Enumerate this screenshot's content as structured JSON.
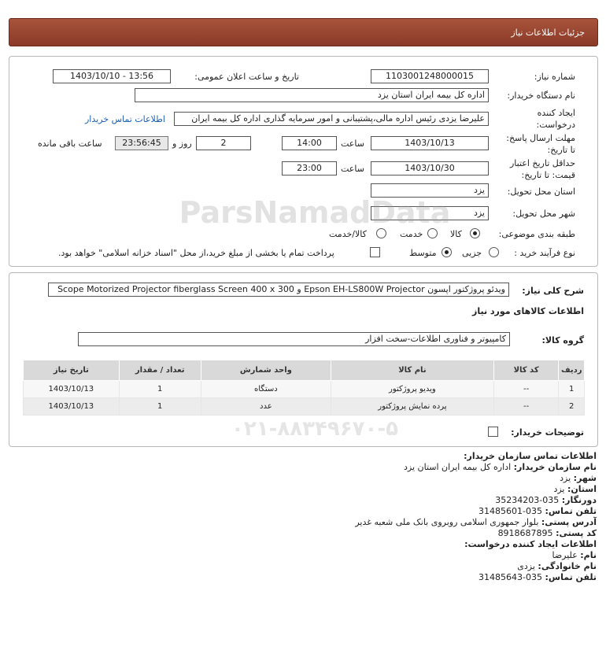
{
  "header": {
    "title": "جزئیات اطلاعات نیاز"
  },
  "form": {
    "need_number_label": "شماره نیاز:",
    "need_number": "1103001248000015",
    "announce_label": "تاریخ و ساعت اعلان عمومی:",
    "announce_value": "1403/10/10 - 13:56",
    "buyer_org_label": "نام دستگاه خریدار:",
    "buyer_org": "اداره کل بیمه ایران استان یزد",
    "creator_label_1": "ایجاد کننده",
    "creator_label_2": "درخواست:",
    "creator": "علیرضا یزدی رئیس اداره مالی،پشتیبانی و امور سرمایه گذاری اداره کل بیمه ایران",
    "buyer_contact_link": "اطلاعات تماس خریدار",
    "reply_deadline_label_1": "مهلت ارسال پاسخ:",
    "reply_deadline_label_2": "تا تاریخ:",
    "reply_date": "1403/10/13",
    "time_label": "ساعت",
    "reply_time": "14:00",
    "days_value": "2",
    "days_label": "روز و",
    "remaining_time": "23:56:45",
    "remaining_label": "ساعت باقی مانده",
    "validity_label_1": "حداقل تاریخ اعتبار",
    "validity_label_2": "قیمت: تا تاریخ:",
    "validity_date": "1403/10/30",
    "validity_time": "23:00",
    "province_label": "استان محل تحویل:",
    "province": "یزد",
    "city_label": "شهر محل تحویل:",
    "city": "یزد",
    "category_label": "طبقه بندی موضوعی:",
    "cat_goods": "کالا",
    "cat_service": "خدمت",
    "cat_goods_service": "کالا/خدمت",
    "process_label": "نوع فرآیند خرید :",
    "proc_partial": "جزیی",
    "proc_medium": "متوسط",
    "payment_note": "پرداخت تمام یا بخشی از مبلغ خرید،از محل \"اسناد خزانه اسلامی\" خواهد بود."
  },
  "need": {
    "desc_label": "شرح کلی نیاز:",
    "desc": "ویدئو پروژکتور اپسون Epson EH-LS800W Projector و Scope Motorized Projector fiberglass Screen 400 x 300",
    "goods_info_title": "اطلاعات کالاهای مورد نیاز",
    "group_label": "گروه کالا:",
    "group_value": "کامپیوتر و فناوری اطلاعات-سخت افزار",
    "table": {
      "headers": [
        "ردیف",
        "کد کالا",
        "نام کالا",
        "واحد شمارش",
        "تعداد / مقدار",
        "تاریخ نیاز"
      ],
      "rows": [
        [
          "1",
          "--",
          "ویدیو پروژکتور",
          "دستگاه",
          "1",
          "1403/10/13"
        ],
        [
          "2",
          "--",
          "پرده نمایش پروژکتور",
          "عدد",
          "1",
          "1403/10/13"
        ]
      ]
    },
    "buyer_notes_label": "توضیحات خریدار:"
  },
  "contact": {
    "title": "اطلاعات تماس سازمان خریدار:",
    "org_label": "نام سازمان خریدار:",
    "org": "اداره کل بیمه ایران استان یزد",
    "city_label": "شهر:",
    "city": "یزد",
    "province_label": "استان:",
    "province": "یزد",
    "fax_label": "دورنگار:",
    "fax": "035-35234203",
    "phone_label": "تلفن تماس:",
    "phone": "035-31485601",
    "address_label": "آدرس پستی:",
    "address": "بلوار جمهوری اسلامی روبروی بانک ملی شعبه غدیر",
    "postal_label": "کد پستی:",
    "postal": "8918687895",
    "creator_title": "اطلاعات ایجاد کننده درخواست:",
    "name_label": "نام:",
    "name": "علیرضا",
    "family_label": "نام خانوادگی:",
    "family": "یزدی",
    "creator_phone_label": "تلفن تماس:",
    "creator_phone": "035-31485643"
  },
  "watermark": {
    "line1": "ParsNamadData",
    "line2": "۰۲۱-۸۸۳۴۹۶۷۰-۵"
  },
  "colors": {
    "header_bg": "#8a3a28",
    "link": "#1a5fb4",
    "table_header": "#d9d9d9"
  }
}
